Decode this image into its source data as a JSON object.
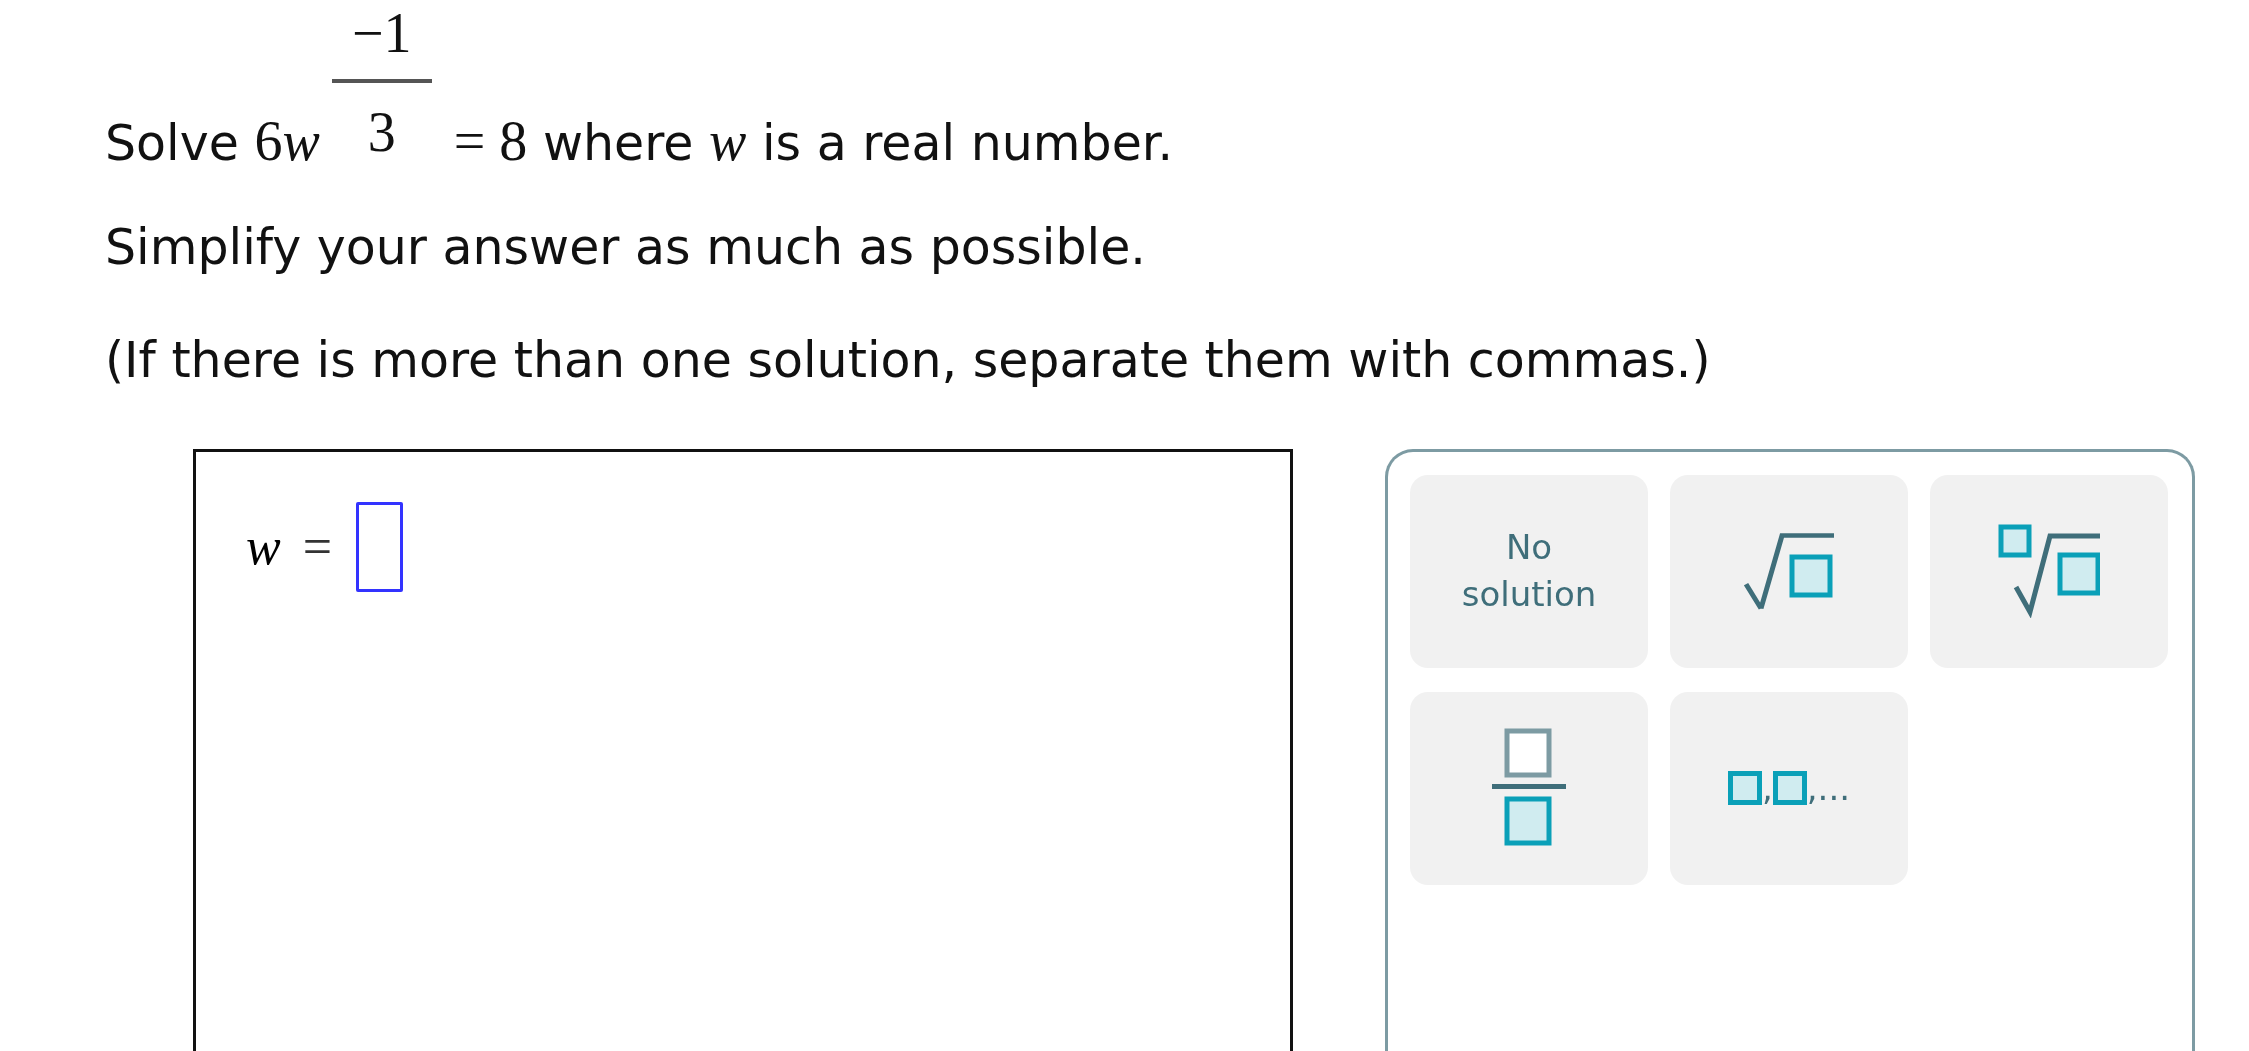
{
  "question": {
    "lead": "Solve",
    "base": "6w",
    "exponent": {
      "numerator": "−1",
      "denominator": "3"
    },
    "rhs": "= 8",
    "middle": "where",
    "variable": "w",
    "tail": "is a real number."
  },
  "instructions": [
    "Simplify your answer as much as possible.",
    "(If there is more than one solution, separate them with commas.)"
  ],
  "answer": {
    "variable": "w",
    "equals": "="
  },
  "keypad": [
    {
      "kind": "text",
      "label": "No solution"
    },
    {
      "kind": "sqrt"
    },
    {
      "kind": "nth-root"
    },
    {
      "kind": "fraction"
    },
    {
      "kind": "list",
      "separator": ",",
      "ellipsis": ",..."
    }
  ]
}
